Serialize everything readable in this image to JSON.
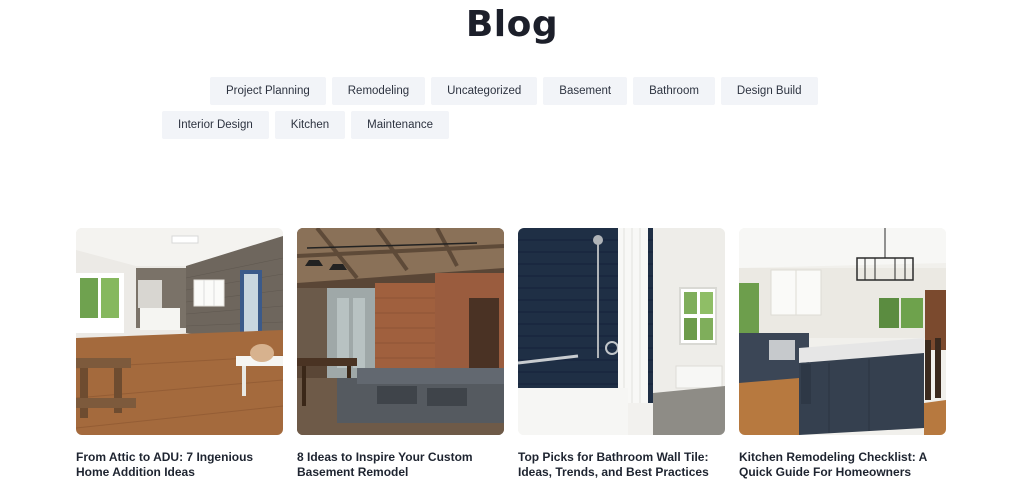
{
  "page": {
    "title": "Blog"
  },
  "categories": {
    "row1": [
      "Project Planning",
      "Remodeling",
      "Uncategorized",
      "Basement",
      "Bathroom",
      "Design Build"
    ],
    "row2": [
      "Interior Design",
      "Kitchen",
      "Maintenance"
    ]
  },
  "posts": [
    {
      "title": "From Attic to ADU: 7 Ingenious Home Addition Ideas",
      "image": "attic-addition-photo"
    },
    {
      "title": "8 Ideas to Inspire Your Custom Basement Remodel",
      "image": "basement-remodel-photo"
    },
    {
      "title": "Top Picks for Bathroom Wall Tile: Ideas, Trends, and Best Practices",
      "image": "bathroom-tile-photo"
    },
    {
      "title": "Kitchen Remodeling Checklist: A Quick Guide For Homeowners",
      "image": "kitchen-remodel-photo"
    }
  ]
}
